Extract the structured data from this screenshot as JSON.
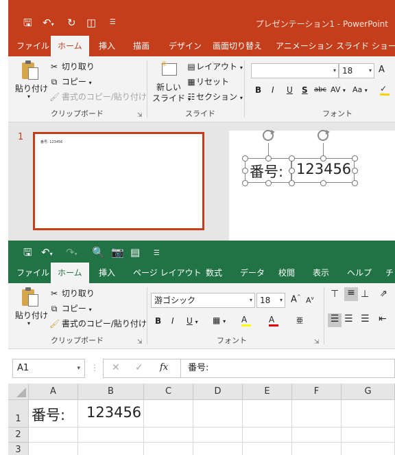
{
  "powerpoint": {
    "window_title": "プレゼンテーション1  -  PowerPoint",
    "accent_color": "#c43e1c",
    "qat_icons": [
      "save-icon",
      "undo-icon",
      "repeat-icon",
      "present-from-start-icon",
      "customize-qat-icon"
    ],
    "tabs": [
      "ファイル",
      "ホーム",
      "挿入",
      "描画",
      "デザイン",
      "画面切り替え",
      "アニメーション",
      "スライド ショー"
    ],
    "active_tab": "ホーム",
    "clipboard": {
      "paste": "貼り付け",
      "cut": "切り取り",
      "copy": "コピー",
      "format_painter": "書式のコピー/貼り付け",
      "group_label": "クリップボード"
    },
    "slides_group": {
      "new_slide_line1": "新しい",
      "new_slide_line2": "スライド",
      "layout": "レイアウト",
      "reset": "リセット",
      "section": "セクション",
      "group_label": "スライド"
    },
    "font_group": {
      "font_name": "",
      "font_size": "18",
      "bold": "B",
      "italic": "I",
      "underline": "U",
      "shadow": "S",
      "strike": "abc",
      "spacing": "AV",
      "case": "Aa",
      "grow": "A",
      "group_label": "フォント"
    },
    "thumbnail": {
      "slide_number": "1",
      "text": "番号:   123456"
    },
    "slide": {
      "textbox1": "番号:",
      "textbox2": "123456"
    }
  },
  "excel": {
    "accent_color": "#217346",
    "qat_icons": [
      "save-icon",
      "undo-icon",
      "redo-icon",
      "print-preview-icon",
      "camera-icon",
      "form-icon",
      "customize-qat-icon"
    ],
    "tabs": [
      "ファイル",
      "ホーム",
      "挿入",
      "ページ レイアウト",
      "数式",
      "データ",
      "校閲",
      "表示",
      "ヘルプ",
      "チ"
    ],
    "active_tab": "ホーム",
    "clipboard": {
      "paste": "貼り付け",
      "cut": "切り取り",
      "copy": "コピー",
      "format_painter": "書式のコピー/貼り付け",
      "group_label": "クリップボード"
    },
    "font_group": {
      "font_name": "游ゴシック",
      "font_size": "18",
      "bold": "B",
      "italic": "I",
      "underline": "U",
      "fill_letter": "A",
      "font_color_letter": "A",
      "phonetic": "亜",
      "group_label": "フォント"
    },
    "name_box": "A1",
    "fx_label": "fx",
    "formula_value": "番号:",
    "columns": [
      "A",
      "B",
      "C",
      "D",
      "E",
      "F",
      "G"
    ],
    "rows": [
      "1",
      "2",
      "3"
    ],
    "cells": {
      "A1": "番号:",
      "B1": "123456"
    }
  }
}
